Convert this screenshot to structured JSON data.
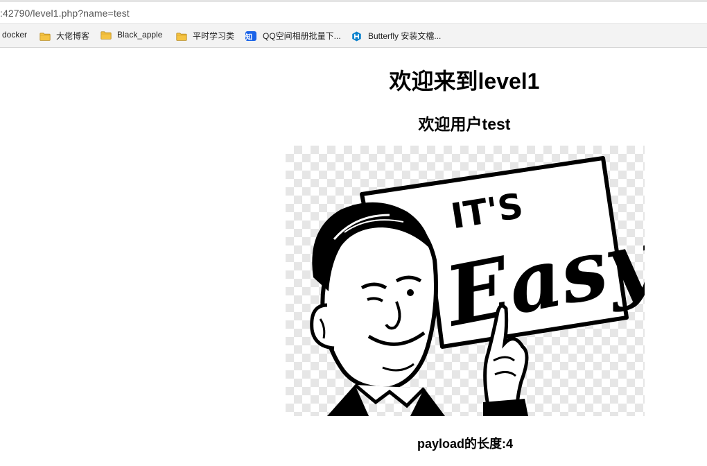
{
  "browser": {
    "url": ":42790/level1.php?name=test"
  },
  "bookmarks": [
    {
      "label": "docker",
      "icon": "none"
    },
    {
      "label": "大佬博客",
      "icon": "folder-icon"
    },
    {
      "label": "Black_apple",
      "icon": "folder-icon"
    },
    {
      "label": "平时学习类",
      "icon": "folder-icon"
    },
    {
      "label": "QQ空间相册批量下...",
      "icon": "zhihu-icon",
      "icon_text": "知"
    },
    {
      "label": "Butterfly 安装文檔...",
      "icon": "hexo-icon"
    }
  ],
  "page": {
    "title": "欢迎来到level1",
    "welcome": "欢迎用户test",
    "payload_length": "payload的长度:4",
    "image": {
      "sign_line1": "IT'S",
      "sign_line2": "Easy"
    }
  },
  "colors": {
    "folder": "#f5c342",
    "zhihu": "#1a63e8",
    "hexo": "#0e83cd"
  }
}
